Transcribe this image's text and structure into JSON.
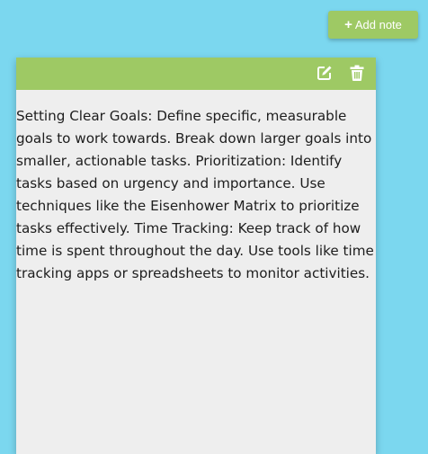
{
  "header": {
    "add_note_label": "Add note",
    "add_icon": "plus-icon"
  },
  "note": {
    "text": "Setting Clear Goals: Define specific, measurable goals to work towards. Break down larger goals into smaller, actionable tasks. Prioritization: Identify tasks based on urgency and importance. Use techniques like the Eisenhower Matrix to prioritize tasks effectively. Time Tracking: Keep track of how time is spent throughout the day. Use tools like time tracking apps or spreadsheets to monitor activities.",
    "edit_icon": "edit-icon",
    "delete_icon": "trash-icon"
  },
  "colors": {
    "background": "#7bd7ef",
    "accent": "#9ec964",
    "note_body": "#eeeeee",
    "text": "#1d1d1d"
  }
}
